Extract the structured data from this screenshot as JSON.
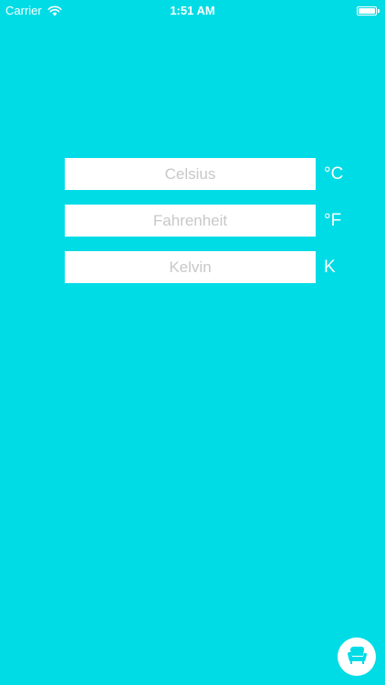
{
  "status_bar": {
    "carrier": "Carrier",
    "time": "1:51 AM",
    "wifi_icon": "wifi-icon",
    "battery_icon": "battery-icon"
  },
  "converter": {
    "celsius": {
      "placeholder": "Celsius",
      "unit": "°C",
      "value": ""
    },
    "fahrenheit": {
      "placeholder": "Fahrenheit",
      "unit": "°F",
      "value": ""
    },
    "kelvin": {
      "placeholder": "Kelvin",
      "unit": "K",
      "value": ""
    }
  },
  "footer": {
    "app_button_icon": "chair-icon"
  },
  "colors": {
    "background": "#00DCE6",
    "field": "#FFFFFF",
    "placeholder": "#C8C8C8",
    "text": "#FFFFFF"
  }
}
